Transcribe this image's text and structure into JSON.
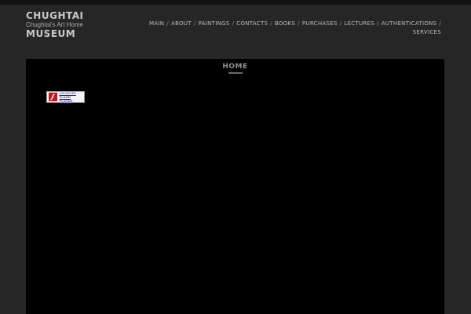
{
  "site": {
    "name_line1": "CHUGHTAI",
    "tagline": "Chughtai's Art Home",
    "name_line2": "MUSEUM"
  },
  "nav": {
    "items": [
      {
        "label": "MAIN"
      },
      {
        "label": "ABOUT"
      },
      {
        "label": "PAINTINGS"
      },
      {
        "label": "CONTACTS"
      },
      {
        "label": "BOOKS"
      },
      {
        "label": "PURCHASES"
      },
      {
        "label": "LECTURES"
      },
      {
        "label": "AUTHENTICATIONS"
      },
      {
        "label": "SERVICES"
      }
    ],
    "separator": "/"
  },
  "page": {
    "title": "HOME"
  },
  "flash_badge": {
    "line1": "Get ADOBE",
    "line2": "FLASH PLAYER",
    "icon": "flash-icon"
  },
  "colors": {
    "page_bg": "#262626",
    "content_bg": "#000000",
    "flash_red": "#c8141e"
  }
}
